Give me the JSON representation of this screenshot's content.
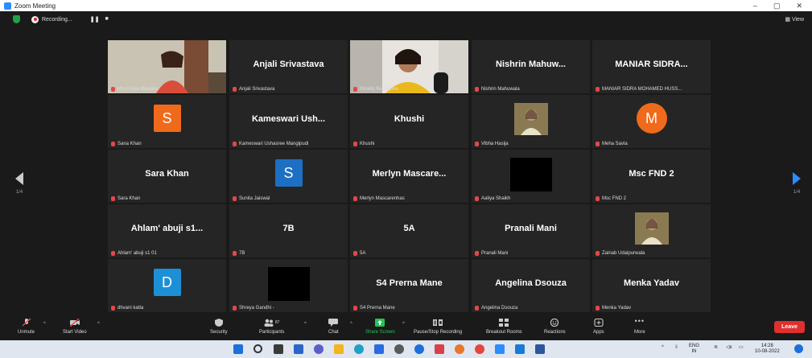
{
  "window": {
    "title": "Zoom Meeting",
    "controls": [
      "–",
      "▢",
      "✕"
    ]
  },
  "topbar": {
    "recording_label": "Recording...",
    "view_label": "View"
  },
  "nav": {
    "left_page": "1/4",
    "right_page": "1/4"
  },
  "tiles": [
    {
      "display": "Mrs Pooja Maulikar",
      "label": "Mrs Pooja Maulikar",
      "kind": "video",
      "active": true
    },
    {
      "display": "Anjali Srivastava",
      "label": "Anjali Srivastava",
      "kind": "name"
    },
    {
      "display": "Minelly Rodrigues",
      "label": "Minelly Rodrigues",
      "kind": "video"
    },
    {
      "display": "Nishrin Mahuw...",
      "label": "Nishrin Mahuwala",
      "kind": "name"
    },
    {
      "display": "MANIAR SIDRA...",
      "label": "MANIAR SIDRA MOHAMED HUSS...",
      "kind": "name"
    },
    {
      "display": "S",
      "label": "Sana Khan",
      "kind": "avatar-square",
      "color": "#f06a1b"
    },
    {
      "display": "Kameswari Ush...",
      "label": "Kameswari Ushasree Mangipudi",
      "kind": "name"
    },
    {
      "display": "Khushi",
      "label": "Khushi",
      "kind": "name"
    },
    {
      "display": "Vibha Hasija",
      "label": "Vibha Hasija",
      "kind": "photo"
    },
    {
      "display": "M",
      "label": "Meha Savla",
      "kind": "avatar-circle",
      "color": "#f06a1b"
    },
    {
      "display": "Sara Khan",
      "label": "Sara Khan",
      "kind": "name"
    },
    {
      "display": "S",
      "label": "Sunita Jaiswal",
      "kind": "avatar-square",
      "color": "#1d6fc3"
    },
    {
      "display": "Merlyn Mascare...",
      "label": "Merlyn Mascarenhas",
      "kind": "name"
    },
    {
      "display": "",
      "label": "Aaliya Shaikh",
      "kind": "black"
    },
    {
      "display": "Msc FND 2",
      "label": "Msc FND 2",
      "kind": "name"
    },
    {
      "display": "Ahlam' abuji s1...",
      "label": "Ahlam' abuji s1 01",
      "kind": "name"
    },
    {
      "display": "7B",
      "label": "7B",
      "kind": "name"
    },
    {
      "display": "5A",
      "label": "5A",
      "kind": "name"
    },
    {
      "display": "Pranali Mani",
      "label": "Pranali Mani",
      "kind": "name"
    },
    {
      "display": "Zainab Udaipurwala",
      "label": "Zainab Udaipurwala",
      "kind": "photo"
    },
    {
      "display": "D",
      "label": "dhvani katta",
      "kind": "avatar-square",
      "color": "#1d8fd6"
    },
    {
      "display": "",
      "label": "Shreya Gandhi -",
      "kind": "black"
    },
    {
      "display": "S4 Prerna Mane",
      "label": "S4 Prerna Mane",
      "kind": "name"
    },
    {
      "display": "Angelina Dsouza",
      "label": "Angelina Dsouza",
      "kind": "name"
    },
    {
      "display": "Menka Yadav",
      "label": "Menka Yadav",
      "kind": "name"
    }
  ],
  "toolbar": {
    "unmute": "Unmute",
    "start_video": "Start Video",
    "security": "Security",
    "participants": "Participants",
    "participants_count": "87",
    "chat": "Chat",
    "share_screen": "Share Screen",
    "pause_recording": "Pause/Stop Recording",
    "breakout_rooms": "Breakout Rooms",
    "reactions": "Reactions",
    "apps": "Apps",
    "more": "More",
    "leave": "Leave",
    "share_color": "#23c552",
    "leave_color": "#e02f2f"
  },
  "taskbar": {
    "lang_top": "ENG",
    "lang_bottom": "IN",
    "time": "14:28",
    "date": "10-08-2022"
  }
}
